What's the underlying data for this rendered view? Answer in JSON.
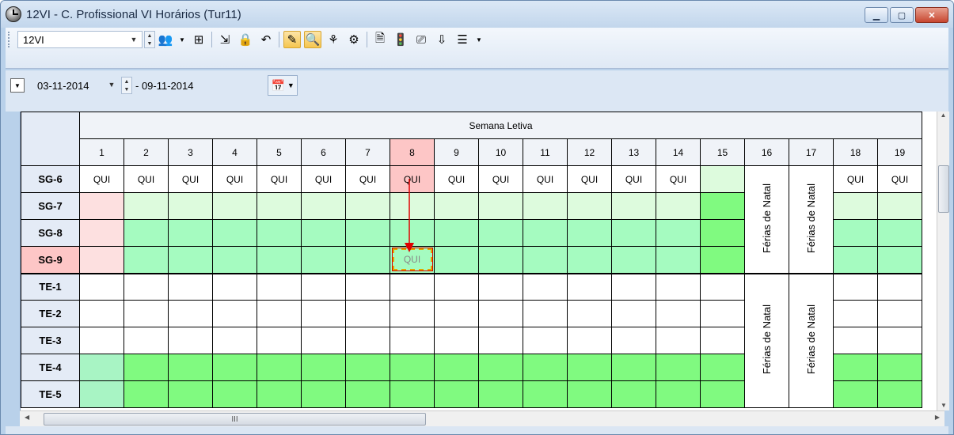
{
  "window": {
    "title": "12VI - C. Profissional VI Horários (Tur11)",
    "buttons": {
      "minimize": "▁",
      "maximize": "▢",
      "close": "✕"
    }
  },
  "toolbar": {
    "class_selector": "12VI",
    "date_from": "03-11-2014",
    "date_to": "- 09-11-2014"
  },
  "grid": {
    "super_header": "Semana Letiva",
    "weeks": [
      "1",
      "2",
      "3",
      "4",
      "5",
      "6",
      "7",
      "8",
      "9",
      "10",
      "11",
      "12",
      "13",
      "14",
      "15",
      "16",
      "17",
      "18",
      "19"
    ],
    "highlight_week": "8",
    "rows": [
      {
        "label": "SG-6",
        "highlight": false
      },
      {
        "label": "SG-7",
        "highlight": false
      },
      {
        "label": "SG-8",
        "highlight": false
      },
      {
        "label": "SG-9",
        "highlight": true
      },
      {
        "label": "TE-1",
        "highlight": false
      },
      {
        "label": "TE-2",
        "highlight": false
      },
      {
        "label": "TE-3",
        "highlight": false
      },
      {
        "label": "TE-4",
        "highlight": false
      },
      {
        "label": "TE-5",
        "highlight": false
      }
    ],
    "cell_text": "QUI",
    "holiday_text": "Férias de Natal",
    "dragged_text": "QUI",
    "scroll_grip": "III",
    "colors": {
      "white": "#ffffff",
      "pink": "#fde0e0",
      "highlight": "#fdc6c6",
      "light_green": "#ddfbdd",
      "mint": "#a5fbc0",
      "green": "#80fa80",
      "pale_mint": "#a8f4c4"
    }
  }
}
